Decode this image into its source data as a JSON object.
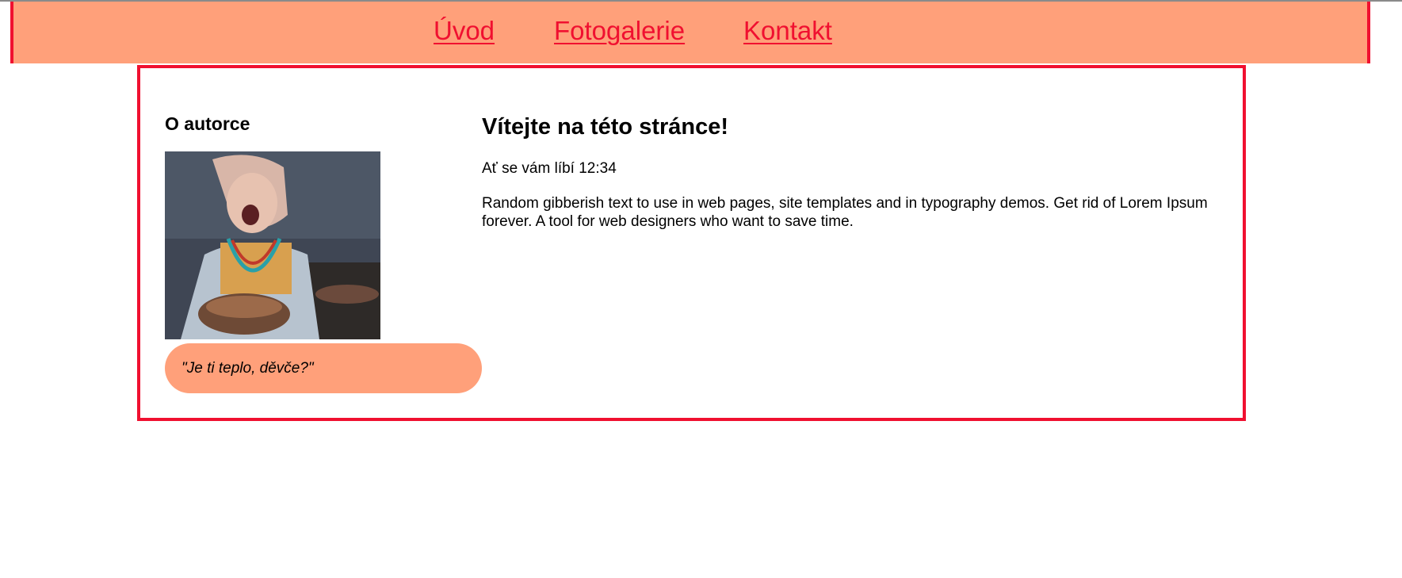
{
  "nav": {
    "items": [
      {
        "label": "Úvod"
      },
      {
        "label": "Fotogalerie"
      },
      {
        "label": "Kontakt"
      }
    ]
  },
  "aside": {
    "title": "O autorce",
    "photo_icon": "portrait-photo",
    "quote": "\"Je ti teplo, děvče?\""
  },
  "main": {
    "title": "Vítejte na této stránce!",
    "subtitle": "Ať se vám líbí 12:34",
    "paragraph": "Random gibberish text to use in web pages, site templates and in typography demos. Get rid of Lorem Ipsum forever. A tool for web designers who want to save time."
  },
  "colors": {
    "accent": "#f01030",
    "header_bg": "#ffa07a",
    "quote_bg": "#ffa07a"
  }
}
